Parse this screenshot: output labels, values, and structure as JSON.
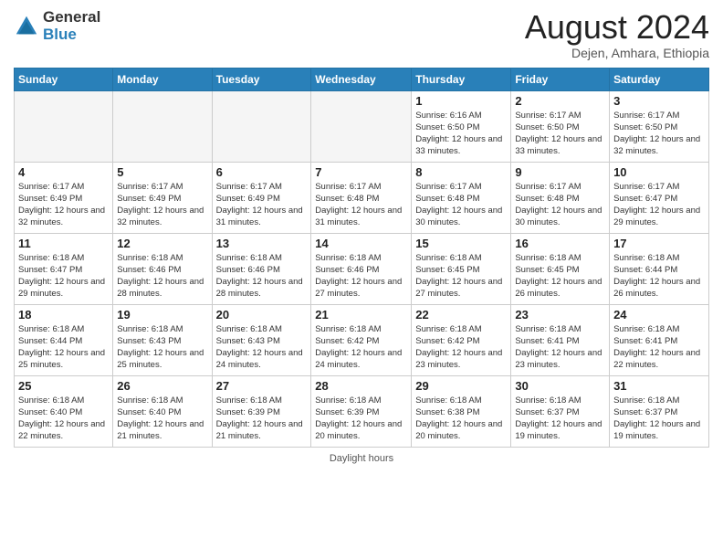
{
  "header": {
    "logo_line1": "General",
    "logo_line2": "Blue",
    "month_title": "August 2024",
    "location": "Dejen, Amhara, Ethiopia"
  },
  "days_of_week": [
    "Sunday",
    "Monday",
    "Tuesday",
    "Wednesday",
    "Thursday",
    "Friday",
    "Saturday"
  ],
  "footer": "Daylight hours",
  "weeks": [
    [
      {
        "day": "",
        "empty": true
      },
      {
        "day": "",
        "empty": true
      },
      {
        "day": "",
        "empty": true
      },
      {
        "day": "",
        "empty": true
      },
      {
        "day": "1",
        "sunrise": "6:16 AM",
        "sunset": "6:50 PM",
        "daylight": "12 hours and 33 minutes."
      },
      {
        "day": "2",
        "sunrise": "6:17 AM",
        "sunset": "6:50 PM",
        "daylight": "12 hours and 33 minutes."
      },
      {
        "day": "3",
        "sunrise": "6:17 AM",
        "sunset": "6:50 PM",
        "daylight": "12 hours and 32 minutes."
      }
    ],
    [
      {
        "day": "4",
        "sunrise": "6:17 AM",
        "sunset": "6:49 PM",
        "daylight": "12 hours and 32 minutes."
      },
      {
        "day": "5",
        "sunrise": "6:17 AM",
        "sunset": "6:49 PM",
        "daylight": "12 hours and 32 minutes."
      },
      {
        "day": "6",
        "sunrise": "6:17 AM",
        "sunset": "6:49 PM",
        "daylight": "12 hours and 31 minutes."
      },
      {
        "day": "7",
        "sunrise": "6:17 AM",
        "sunset": "6:48 PM",
        "daylight": "12 hours and 31 minutes."
      },
      {
        "day": "8",
        "sunrise": "6:17 AM",
        "sunset": "6:48 PM",
        "daylight": "12 hours and 30 minutes."
      },
      {
        "day": "9",
        "sunrise": "6:17 AM",
        "sunset": "6:48 PM",
        "daylight": "12 hours and 30 minutes."
      },
      {
        "day": "10",
        "sunrise": "6:17 AM",
        "sunset": "6:47 PM",
        "daylight": "12 hours and 29 minutes."
      }
    ],
    [
      {
        "day": "11",
        "sunrise": "6:18 AM",
        "sunset": "6:47 PM",
        "daylight": "12 hours and 29 minutes."
      },
      {
        "day": "12",
        "sunrise": "6:18 AM",
        "sunset": "6:46 PM",
        "daylight": "12 hours and 28 minutes."
      },
      {
        "day": "13",
        "sunrise": "6:18 AM",
        "sunset": "6:46 PM",
        "daylight": "12 hours and 28 minutes."
      },
      {
        "day": "14",
        "sunrise": "6:18 AM",
        "sunset": "6:46 PM",
        "daylight": "12 hours and 27 minutes."
      },
      {
        "day": "15",
        "sunrise": "6:18 AM",
        "sunset": "6:45 PM",
        "daylight": "12 hours and 27 minutes."
      },
      {
        "day": "16",
        "sunrise": "6:18 AM",
        "sunset": "6:45 PM",
        "daylight": "12 hours and 26 minutes."
      },
      {
        "day": "17",
        "sunrise": "6:18 AM",
        "sunset": "6:44 PM",
        "daylight": "12 hours and 26 minutes."
      }
    ],
    [
      {
        "day": "18",
        "sunrise": "6:18 AM",
        "sunset": "6:44 PM",
        "daylight": "12 hours and 25 minutes."
      },
      {
        "day": "19",
        "sunrise": "6:18 AM",
        "sunset": "6:43 PM",
        "daylight": "12 hours and 25 minutes."
      },
      {
        "day": "20",
        "sunrise": "6:18 AM",
        "sunset": "6:43 PM",
        "daylight": "12 hours and 24 minutes."
      },
      {
        "day": "21",
        "sunrise": "6:18 AM",
        "sunset": "6:42 PM",
        "daylight": "12 hours and 24 minutes."
      },
      {
        "day": "22",
        "sunrise": "6:18 AM",
        "sunset": "6:42 PM",
        "daylight": "12 hours and 23 minutes."
      },
      {
        "day": "23",
        "sunrise": "6:18 AM",
        "sunset": "6:41 PM",
        "daylight": "12 hours and 23 minutes."
      },
      {
        "day": "24",
        "sunrise": "6:18 AM",
        "sunset": "6:41 PM",
        "daylight": "12 hours and 22 minutes."
      }
    ],
    [
      {
        "day": "25",
        "sunrise": "6:18 AM",
        "sunset": "6:40 PM",
        "daylight": "12 hours and 22 minutes."
      },
      {
        "day": "26",
        "sunrise": "6:18 AM",
        "sunset": "6:40 PM",
        "daylight": "12 hours and 21 minutes."
      },
      {
        "day": "27",
        "sunrise": "6:18 AM",
        "sunset": "6:39 PM",
        "daylight": "12 hours and 21 minutes."
      },
      {
        "day": "28",
        "sunrise": "6:18 AM",
        "sunset": "6:39 PM",
        "daylight": "12 hours and 20 minutes."
      },
      {
        "day": "29",
        "sunrise": "6:18 AM",
        "sunset": "6:38 PM",
        "daylight": "12 hours and 20 minutes."
      },
      {
        "day": "30",
        "sunrise": "6:18 AM",
        "sunset": "6:37 PM",
        "daylight": "12 hours and 19 minutes."
      },
      {
        "day": "31",
        "sunrise": "6:18 AM",
        "sunset": "6:37 PM",
        "daylight": "12 hours and 19 minutes."
      }
    ]
  ]
}
